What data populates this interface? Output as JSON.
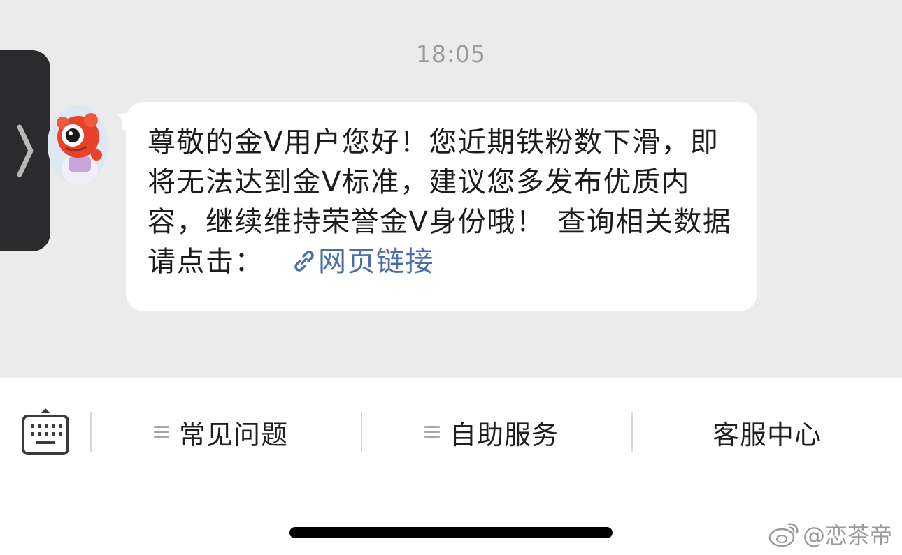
{
  "chat": {
    "timestamp": "18:05",
    "message": {
      "text": "尊敬的金V用户您好！您近期铁粉数下滑，即将无法达到金V标准，建议您多发布优质内容，继续维持荣誉金V身份哦！",
      "query_text": "查询相关数据请点击：",
      "link_label": "网页链接"
    }
  },
  "bottom_bar": {
    "menu": [
      {
        "label": "常见问题",
        "has_menu_icon": true
      },
      {
        "label": "自助服务",
        "has_menu_icon": true
      },
      {
        "label": "客服中心",
        "has_menu_icon": false
      }
    ]
  },
  "watermark": {
    "text": "@恋茶帝"
  },
  "colors": {
    "background": "#ebebeb",
    "bubble": "#ffffff",
    "link": "#4a6ea8",
    "side_tab": "#2b2b2d"
  },
  "icons": [
    "chevron-right-icon",
    "keyboard-icon",
    "menu-lines-icon",
    "link-icon",
    "weibo-logo-icon"
  ]
}
